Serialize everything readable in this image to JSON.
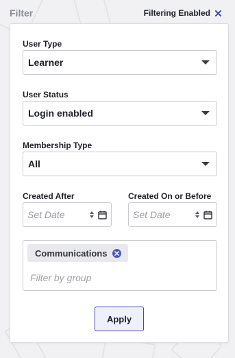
{
  "header": {
    "title": "Filter",
    "status": "Filtering Enabled",
    "clear_icon": "close-icon",
    "accent_color": "#3b46b0"
  },
  "fields": {
    "user_type": {
      "label": "User Type",
      "value": "Learner"
    },
    "user_status": {
      "label": "User Status",
      "value": "Login enabled"
    },
    "membership_type": {
      "label": "Membership Type",
      "value": "All"
    },
    "created_after": {
      "label": "Created After",
      "placeholder": "Set Date"
    },
    "created_before": {
      "label": "Created On or Before",
      "placeholder": "Set Date"
    }
  },
  "groups": {
    "chips": [
      {
        "label": "Communications"
      }
    ],
    "placeholder": "Filter by group"
  },
  "apply_label": "Apply"
}
